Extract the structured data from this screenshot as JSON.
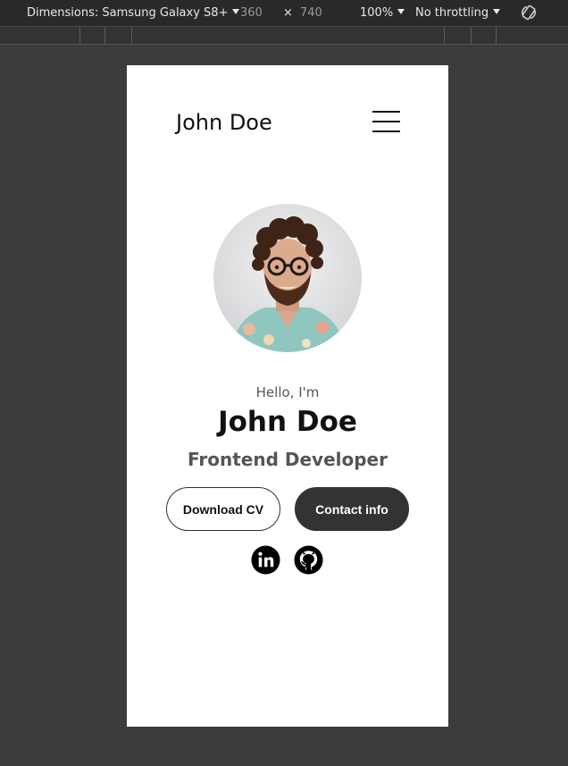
{
  "toolbar": {
    "dimensions_label": "Dimensions: Samsung Galaxy S8+",
    "width": "360",
    "times": "×",
    "height": "740",
    "zoom": "100%",
    "throttling": "No throttling",
    "rotate_icon": "rotate-icon"
  },
  "nav": {
    "brand": "John Doe",
    "menu_icon": "hamburger-icon"
  },
  "hero": {
    "greeting": "Hello, I'm",
    "name": "John Doe",
    "role": "Frontend Developer",
    "download_label": "Download CV",
    "contact_label": "Contact info",
    "social_icons": [
      "linkedin-icon",
      "github-icon"
    ]
  },
  "colors": {
    "page_bg": "#3c3c3c",
    "toolbar_bg": "#292929",
    "button_dark": "#333333",
    "text_dark": "#111111",
    "text_muted": "#555555"
  }
}
